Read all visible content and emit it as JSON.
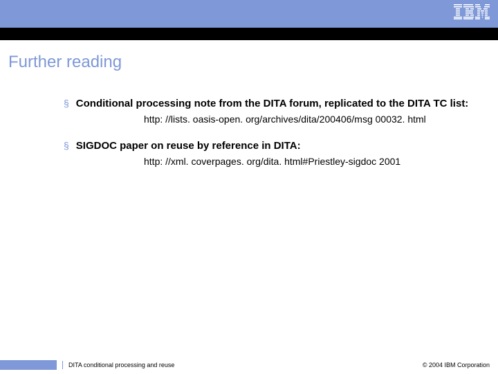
{
  "header": {
    "logo_name": "ibm-logo"
  },
  "slide": {
    "title": "Further reading"
  },
  "bullets": [
    {
      "text": "Conditional processing note from the DITA forum, replicated to the DITA TC list:",
      "link": "http: //lists. oasis-open. org/archives/dita/200406/msg 00032. html"
    },
    {
      "text": "SIGDOC paper on reuse by reference in DITA:",
      "link": "http: //xml. coverpages. org/dita. html#Priestley-sigdoc 2001"
    }
  ],
  "footer": {
    "presentation_title": "DITA  conditional processing and reuse",
    "copyright": "© 2004 IBM Corporation"
  }
}
